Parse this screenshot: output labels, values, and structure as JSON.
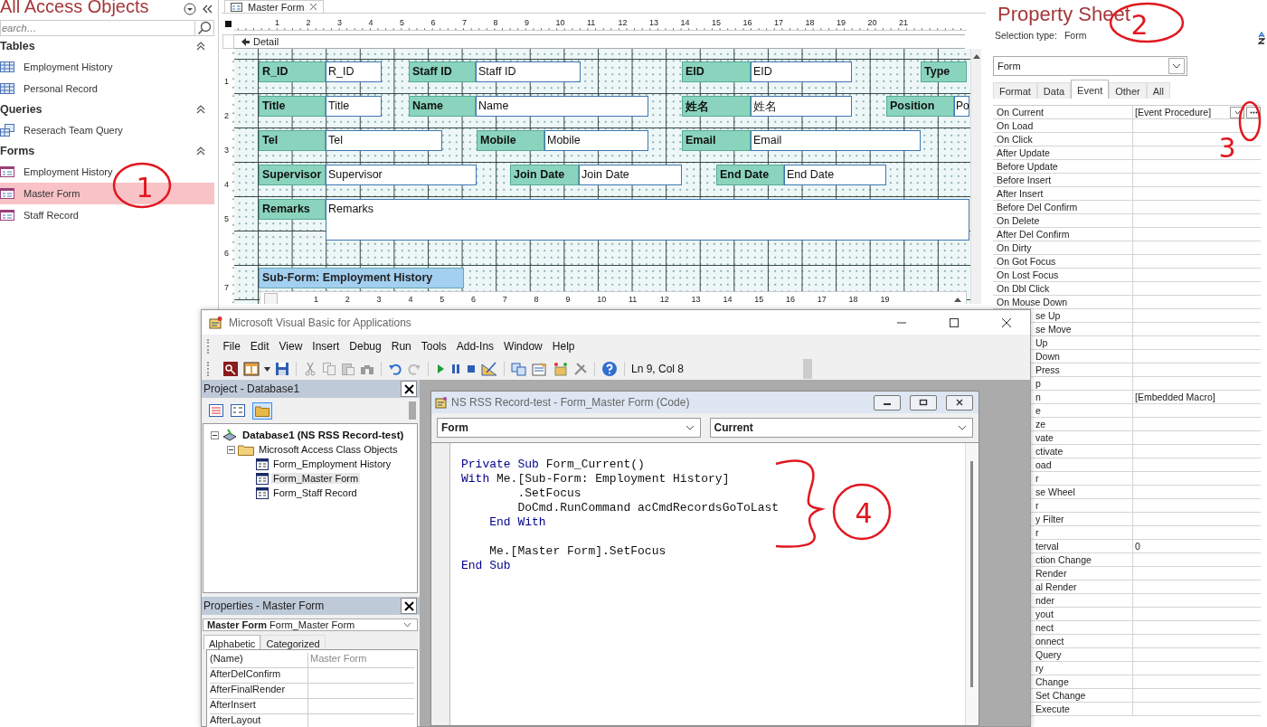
{
  "navigation_pane": {
    "title": "All Access Objects",
    "search": {
      "placeholder": "earch…"
    },
    "groups": [
      {
        "label": "Tables",
        "expanded": true,
        "items": [
          {
            "label": "Employment History",
            "kind": "table",
            "selected": false
          },
          {
            "label": "Personal Record",
            "kind": "table",
            "selected": false
          }
        ]
      },
      {
        "label": "Queries",
        "expanded": true,
        "items": [
          {
            "label": "Reserach Team Query",
            "kind": "query",
            "selected": false
          }
        ]
      },
      {
        "label": "Forms",
        "expanded": true,
        "items": [
          {
            "label": "Employment History",
            "kind": "form",
            "selected": false
          },
          {
            "label": "Master Form",
            "kind": "form",
            "selected": true
          },
          {
            "label": "Staff Record",
            "kind": "form",
            "selected": false
          }
        ]
      }
    ]
  },
  "form_designer": {
    "tab": "Master Form",
    "section": "Detail",
    "ruler_horizontal": [
      "1",
      "2",
      "3",
      "4",
      "5",
      "6",
      "7",
      "8",
      "9",
      "10",
      "11",
      "12",
      "13",
      "14",
      "15",
      "16",
      "17",
      "18",
      "19",
      "20",
      "21"
    ],
    "ruler_vertical": [
      "1",
      "2",
      "3",
      "4",
      "5",
      "6",
      "7"
    ],
    "fields": [
      {
        "label": "R_ID",
        "source": "R_ID",
        "kind": "single"
      },
      {
        "label": "Staff ID",
        "source": "Staff ID",
        "kind": "single"
      },
      {
        "label": "EID",
        "source": "EID",
        "kind": "single"
      },
      {
        "label": "Type"
      },
      {
        "label": "Title",
        "source": "Title",
        "kind": "single"
      },
      {
        "label": "Name",
        "source": "Name",
        "kind": "single"
      },
      {
        "label": "姓名",
        "source": "姓名",
        "kind": "single"
      },
      {
        "label": "Position",
        "source": "Po",
        "kind": "single"
      },
      {
        "label": "Tel",
        "source": "Tel",
        "kind": "single"
      },
      {
        "label": "Mobile",
        "source": "Mobile",
        "kind": "single"
      },
      {
        "label": "Email",
        "source": "Email",
        "kind": "single"
      },
      {
        "label": "Supervisor",
        "source": "Supervisor",
        "kind": "single"
      },
      {
        "label": "Join Date",
        "source": "Join Date",
        "kind": "single"
      },
      {
        "label": "End Date",
        "source": "End Date",
        "kind": "single"
      },
      {
        "label": "Remarks",
        "source": "Remarks",
        "kind": "multiline"
      }
    ],
    "subform": {
      "label": "Sub-Form: Employment History",
      "ruler": [
        "1",
        "2",
        "3",
        "4",
        "5",
        "6",
        "7",
        "8",
        "9",
        "10",
        "11",
        "12",
        "13",
        "14",
        "15",
        "16",
        "17",
        "18",
        "19"
      ]
    }
  },
  "property_sheet": {
    "title": "Property Sheet",
    "selection_type_label": "Selection type:",
    "selection_type": "Form",
    "object": "Form",
    "tabs": [
      {
        "label": "Format",
        "selected": false
      },
      {
        "label": "Data",
        "selected": false
      },
      {
        "label": "Event",
        "selected": true
      },
      {
        "label": "Other",
        "selected": false
      },
      {
        "label": "All",
        "selected": false
      }
    ],
    "rows": [
      {
        "name": "On Current",
        "value": "[Event Procedure]",
        "kind": "full",
        "focused": true
      },
      {
        "name": "On Load",
        "kind": "full"
      },
      {
        "name": "On Click",
        "kind": "full"
      },
      {
        "name": "After Update",
        "kind": "full"
      },
      {
        "name": "Before Update",
        "kind": "full"
      },
      {
        "name": "Before Insert",
        "kind": "full"
      },
      {
        "name": "After Insert",
        "kind": "full"
      },
      {
        "name": "Before Del Confirm",
        "kind": "full"
      },
      {
        "name": "On Delete",
        "kind": "full"
      },
      {
        "name": "After Del Confirm",
        "kind": "full"
      },
      {
        "name": "On Dirty",
        "kind": "full"
      },
      {
        "name": "On Got Focus",
        "kind": "full"
      },
      {
        "name": "On Lost Focus",
        "kind": "full"
      },
      {
        "name": "On Dbl Click",
        "kind": "full"
      },
      {
        "name": "On Mouse Down",
        "kind": "full"
      },
      {
        "name": "se Up",
        "kind": "partial"
      },
      {
        "name": "se Move",
        "kind": "partial"
      },
      {
        "name": "Up",
        "kind": "partial"
      },
      {
        "name": "Down",
        "kind": "partial"
      },
      {
        "name": "Press",
        "kind": "partial"
      },
      {
        "name": "p",
        "kind": "partial"
      },
      {
        "name": "n",
        "value": "[Embedded Macro]",
        "kind": "partial"
      },
      {
        "name": "e",
        "kind": "partial"
      },
      {
        "name": "ze",
        "kind": "partial"
      },
      {
        "name": "vate",
        "kind": "partial"
      },
      {
        "name": "ctivate",
        "kind": "partial"
      },
      {
        "name": "oad",
        "kind": "partial"
      },
      {
        "name": "r",
        "kind": "partial"
      },
      {
        "name": "se Wheel",
        "kind": "partial"
      },
      {
        "name": "r",
        "kind": "partial"
      },
      {
        "name": "y Filter",
        "kind": "partial"
      },
      {
        "name": "r",
        "kind": "partial"
      },
      {
        "name": "terval",
        "value": "0",
        "kind": "partial"
      },
      {
        "name": "ction Change",
        "kind": "partial"
      },
      {
        "name": "Render",
        "kind": "partial"
      },
      {
        "name": "al Render",
        "kind": "partial"
      },
      {
        "name": "nder",
        "kind": "partial"
      },
      {
        "name": "yout",
        "kind": "partial"
      },
      {
        "name": "nect",
        "kind": "partial"
      },
      {
        "name": "onnect",
        "kind": "partial"
      },
      {
        "name": "Query",
        "kind": "partial"
      },
      {
        "name": "ry",
        "kind": "partial"
      },
      {
        "name": "Change",
        "kind": "partial"
      },
      {
        "name": "Set Change",
        "kind": "partial"
      },
      {
        "name": "Execute",
        "kind": "partial"
      }
    ]
  },
  "vba_editor": {
    "title": "Microsoft Visual Basic for Applications",
    "menu": [
      "File",
      "Edit",
      "View",
      "Insert",
      "Debug",
      "Run",
      "Tools",
      "Add-Ins",
      "Window",
      "Help"
    ],
    "position": "Ln 9, Col 8",
    "project": {
      "title": "Project - Database1",
      "tree": [
        {
          "label": "Database1 (NS RSS Record-test)",
          "expanded": true,
          "selected": false,
          "children": [
            {
              "label": "Microsoft Access Class Objects",
              "expanded": true,
              "selected": false,
              "children": [
                {
                  "label": "Form_Employment History",
                  "selected": false
                },
                {
                  "label": "Form_Master Form",
                  "selected": true
                },
                {
                  "label": "Form_Staff Record",
                  "selected": false
                }
              ]
            }
          ]
        }
      ]
    },
    "properties": {
      "title": "Properties - Master Form",
      "object": "**Master Form** Form_Master Form",
      "tabs": [
        {
          "label": "Alphabetic",
          "selected": true
        },
        {
          "label": "Categorized",
          "selected": false
        }
      ],
      "rows": [
        {
          "name": "(Name)",
          "value": "Master Form"
        },
        {
          "name": "AfterDelConfirm"
        },
        {
          "name": "AfterFinalRender"
        },
        {
          "name": "AfterInsert"
        },
        {
          "name": "AfterLayout"
        }
      ]
    },
    "code_window": {
      "title": "NS RSS Record-test - Form_Master Form (Code)",
      "object": "Form",
      "procedure": "Current",
      "lines": [
        {
          "segments": [
            {
              "text": "Private Sub",
              "kind": "keyword"
            },
            {
              "text": " Form_Current()",
              "kind": "plain"
            }
          ]
        },
        {
          "segments": [
            {
              "text": "With",
              "kind": "keyword"
            },
            {
              "text": " Me.[Sub-Form: Employment History]",
              "kind": "plain"
            }
          ]
        },
        {
          "segments": [
            {
              "text": "        .SetFocus",
              "kind": "plain"
            }
          ]
        },
        {
          "segments": [
            {
              "text": "        DoCmd.RunCommand acCmdRecordsGoToLast",
              "kind": "plain"
            }
          ]
        },
        {
          "segments": [
            {
              "text": "    End With",
              "kind": "keyword"
            }
          ]
        },
        {
          "space_before": true,
          "segments": [
            {
              "text": "    Me.[Master Form].SetFocus",
              "kind": "plain"
            }
          ]
        },
        {
          "segments": [
            {
              "text": "End Sub",
              "kind": "keyword"
            }
          ]
        }
      ]
    }
  },
  "annotations": [
    {
      "label": "1",
      "kind": "circled"
    },
    {
      "label": "2",
      "kind": "circled"
    },
    {
      "label": "3",
      "kind": "pointer"
    },
    {
      "label": "4",
      "kind": "brace"
    }
  ]
}
